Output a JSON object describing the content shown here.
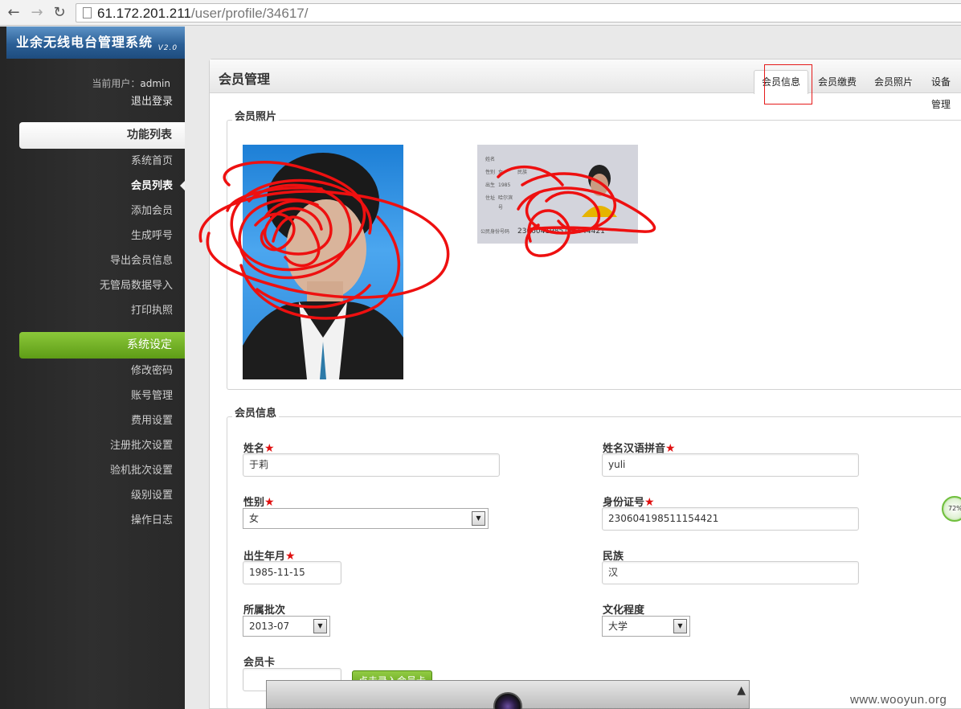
{
  "browser": {
    "url_host": "61.172.201.211",
    "url_path": "/user/profile/34617/"
  },
  "sidebar": {
    "logo_text": "业余无线电台管理系统",
    "logo_version": "V2.0",
    "current_user_label": "当前用户：",
    "current_user": "admin",
    "logout": "退出登录",
    "section1": "功能列表",
    "section1_items": [
      "系统首页",
      "会员列表",
      "添加会员",
      "生成呼号",
      "导出会员信息",
      "无管局数据导入",
      "打印执照"
    ],
    "section2": "系统设定",
    "section2_items": [
      "修改密码",
      "账号管理",
      "费用设置",
      "注册批次设置",
      "验机批次设置",
      "级别设置",
      "操作日志"
    ]
  },
  "panel": {
    "title": "会员管理",
    "tabs": [
      "会员信息",
      "会员缴费",
      "会员照片",
      "设备管理"
    ]
  },
  "photos": {
    "legend": "会员照片",
    "id_card_text": {
      "name_label": "姓名",
      "sex_label": "性别",
      "sex": "女",
      "ethnic_label": "民族",
      "birth_label": "出生",
      "birth_year": "1985",
      "address_label": "住址",
      "address_start": "哈尔滨",
      "address_cont": "号",
      "id_label": "公民身份号码",
      "id_number": "2306041985111544421"
    }
  },
  "form": {
    "legend": "会员信息",
    "name_label": "姓名",
    "name_value": "于莉",
    "pinyin_label": "姓名汉语拼音",
    "pinyin_value": "yuli",
    "sex_label": "性别",
    "sex_value": "女",
    "id_label": "身份证号",
    "id_value": "230604198511154421",
    "birth_label": "出生年月",
    "birth_value": "1985-11-15",
    "ethnic_label": "民族",
    "ethnic_value": "汉",
    "batch_label": "所属批次",
    "batch_value": "2013-07",
    "edu_label": "文化程度",
    "edu_value": "大学",
    "card_label": "会员卡",
    "card_button": "点击录入会员卡",
    "required_star": "★"
  },
  "misc": {
    "speed_badge": "72%",
    "watermark": "www.wooyun.org"
  }
}
